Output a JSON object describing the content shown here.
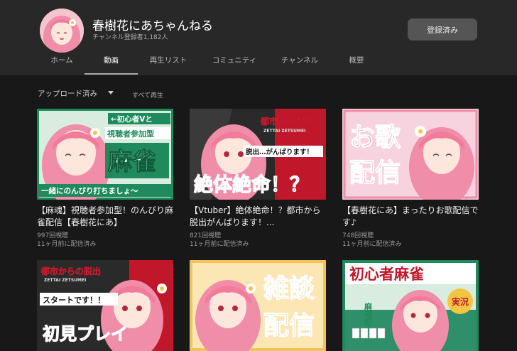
{
  "channel": {
    "name": "春樹花にあちゃんねる",
    "subscribers": "チャンネル登録者1,182人",
    "subscribe_label": "登録済み"
  },
  "tabs": [
    {
      "label": "ホーム",
      "active": false
    },
    {
      "label": "動画",
      "active": true
    },
    {
      "label": "再生リスト",
      "active": false
    },
    {
      "label": "コミュニティ",
      "active": false
    },
    {
      "label": "チャンネル",
      "active": false
    },
    {
      "label": "概要",
      "active": false
    }
  ],
  "filter": {
    "sort_label": "アップロード済み",
    "play_all_label": "すべて再生"
  },
  "videos": [
    {
      "title": "【麻魂】視聴者参加型！のんびり麻雀配信【春樹花にあ】",
      "views": "997回視聴",
      "ago": "11ヶ月前に配信済み",
      "thumb_lines": [
        "←初心者Vと",
        "視聴者参加型",
        "麻雀",
        "一緒にのんびり打ちましょ〜"
      ],
      "thumb_bg": "#1f8a5c"
    },
    {
      "title": "【Vtuber】絶体絶命！？都市から脱出がんばります！...",
      "views": "821回視聴",
      "ago": "11ヶ月前に配信済み",
      "thumb_lines": [
        "都市からの脱出",
        "ZETTAI ZETSUMEI",
        "脱出…がんばります！",
        "絶体絶命！？"
      ],
      "thumb_bg": "#2a2a2a"
    },
    {
      "title": "【春樹花にあ】まったりお歌配信です♪",
      "views": "748回視聴",
      "ago": "11ヶ月前に配信済み",
      "thumb_lines": [
        "お歌",
        "配信"
      ],
      "thumb_bg": "#f7d3df"
    },
    {
      "title": "",
      "views": "",
      "ago": "",
      "thumb_lines": [
        "都市からの脱出",
        "ZETTAI ZETSUMEI",
        "スタートです！！",
        "初見プレイ"
      ],
      "thumb_bg": "#2a2a2a"
    },
    {
      "title": "",
      "views": "",
      "ago": "",
      "thumb_lines": [
        "雑談",
        "配信"
      ],
      "thumb_bg": "#f2c35a"
    },
    {
      "title": "",
      "views": "",
      "ago": "",
      "thumb_lines": [
        "初心者麻雀",
        "麻魂配信",
        "実況"
      ],
      "thumb_bg": "#1f8a5c"
    }
  ],
  "colors": {
    "header_bg": "#282828",
    "page_bg": "#181818",
    "subscribe_btn_bg": "#555555"
  }
}
